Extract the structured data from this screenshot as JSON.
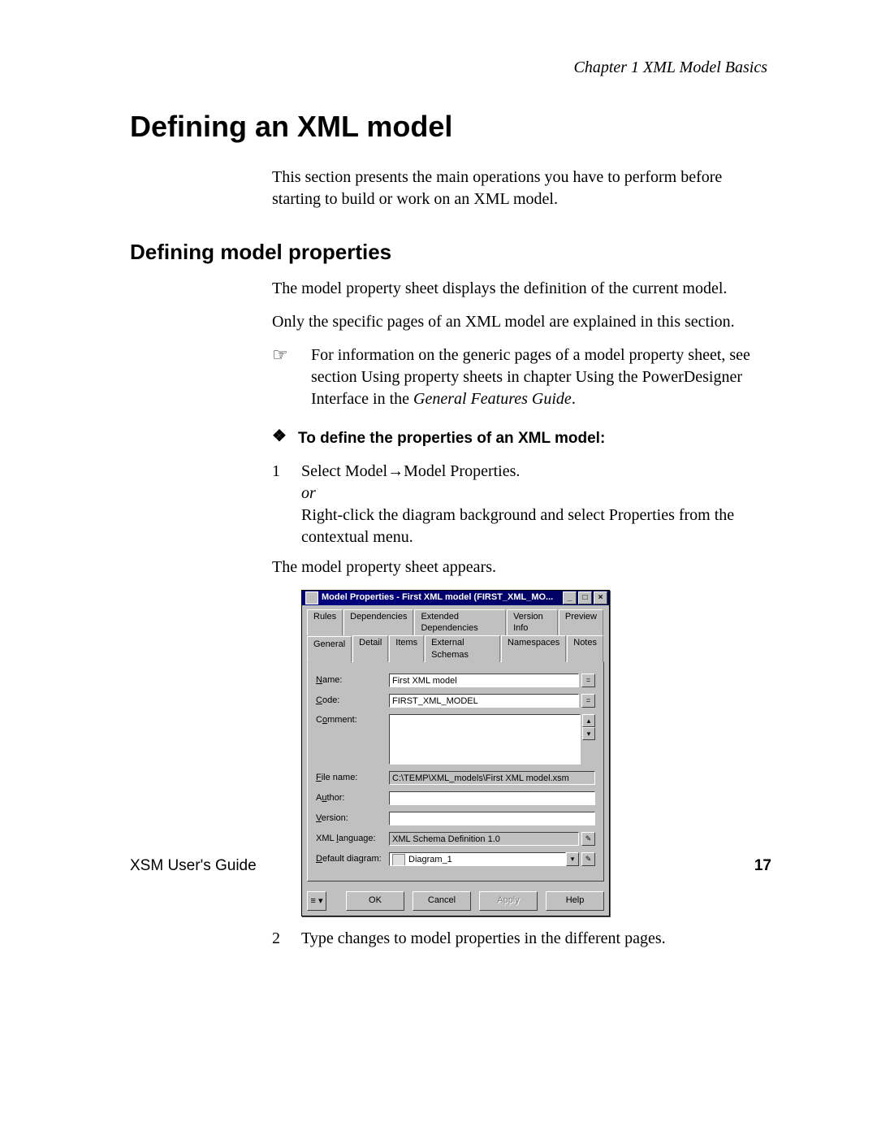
{
  "header": {
    "chapter": "Chapter 1    XML Model Basics"
  },
  "h1": "Defining an XML model",
  "intro": "This section presents the main operations you have to perform before starting to build or work on an XML model.",
  "h2": "Defining model properties",
  "p1": "The model property sheet displays the definition of the current model.",
  "p2": "Only the specific pages of an XML model are explained in this section.",
  "xref_icon": "☞",
  "xref": "For information on the generic pages of a model property sheet, see section Using property sheets in chapter Using the PowerDesigner Interface in the ",
  "xref_em": "General Features Guide",
  "xref_tail": ".",
  "proc_bullet": "❖",
  "proc_heading": "To define the properties of an XML model:",
  "steps": {
    "s1_num": "1",
    "s1a": "Select Model→Model Properties.",
    "s1_or": "or",
    "s1b": "Right-click the diagram background and select Properties from the contextual menu.",
    "s1c": "The model property sheet appears.",
    "s2_num": "2",
    "s2": "Type changes to model properties in the different pages."
  },
  "dialog": {
    "title": "Model Properties - First XML model (FIRST_XML_MO...",
    "win_min": "_",
    "win_max": "□",
    "win_close": "×",
    "tabs_row1": [
      "Rules",
      "Dependencies",
      "Extended Dependencies",
      "Version Info",
      "Preview"
    ],
    "tabs_row2": [
      "General",
      "Detail",
      "Items",
      "External Schemas",
      "Namespaces",
      "Notes"
    ],
    "active_tab": "General",
    "fields": {
      "name_label": "Name:",
      "name_value": "First XML model",
      "code_label": "Code:",
      "code_value": "FIRST_XML_MODEL",
      "comment_label": "Comment:",
      "comment_value": "",
      "filename_label": "File name:",
      "filename_value": "C:\\TEMP\\XML_models\\First XML model.xsm",
      "author_label": "Author:",
      "author_value": "",
      "version_label": "Version:",
      "version_value": "",
      "xmllang_label": "XML language:",
      "xmllang_value": "XML Schema Definition 1.0",
      "defdiag_label": "Default diagram:",
      "defdiag_value": "Diagram_1",
      "eq_btn": "=",
      "props_btn": "✎",
      "scroll_up": "▴",
      "scroll_down": "▾",
      "dd_arrow": "▾"
    },
    "buttons": {
      "menu": "≡ ▾",
      "ok": "OK",
      "cancel": "Cancel",
      "apply": "Apply",
      "help": "Help"
    }
  },
  "footer": {
    "left": "XSM User's Guide",
    "page": "17"
  }
}
